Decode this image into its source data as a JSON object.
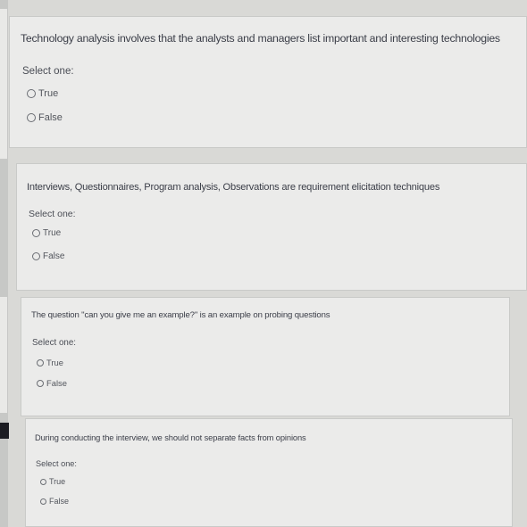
{
  "questions": [
    {
      "text": "Technology analysis involves that the analysts and managers list important and interesting technologies",
      "select_label": "Select one:",
      "options": [
        "True",
        "False"
      ]
    },
    {
      "text": "Interviews, Questionnaires, Program analysis, Observations are requirement elicitation techniques",
      "select_label": "Select one:",
      "options": [
        "True",
        "False"
      ]
    },
    {
      "text": "The question \"can you give me an example?\" is an example on probing questions",
      "select_label": "Select one:",
      "options": [
        "True",
        "False"
      ]
    },
    {
      "text": "During conducting the interview, we should not separate facts from opinions",
      "select_label": "Select one:",
      "options": [
        "True",
        "False"
      ]
    }
  ]
}
